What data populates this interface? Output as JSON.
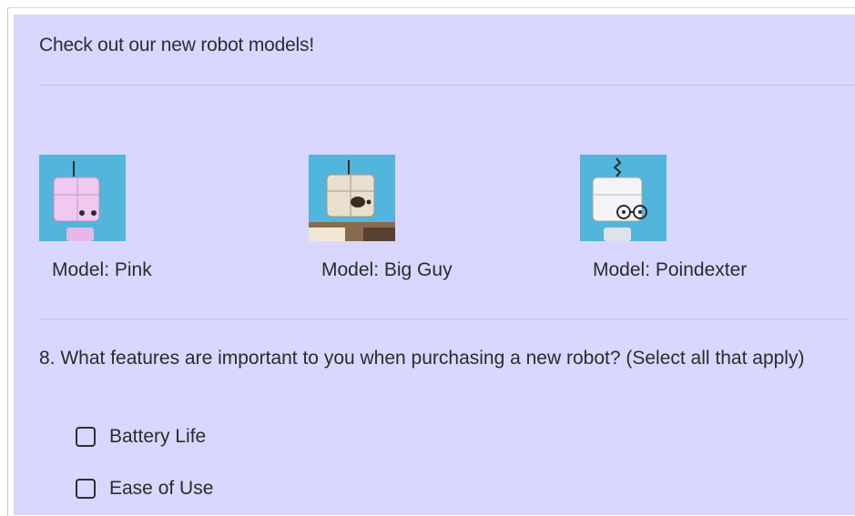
{
  "intro": {
    "text": "Check out our new robot models!"
  },
  "models": [
    {
      "caption": "Model: Pink",
      "image_icon": "robot-pink-icon"
    },
    {
      "caption": "Model: Big Guy",
      "image_icon": "robot-big-guy-icon"
    },
    {
      "caption": "Model: Poindexter",
      "image_icon": "robot-poindexter-icon"
    }
  ],
  "question": {
    "text": "8. What features are important to you when purchasing a new robot? (Select all that apply)"
  },
  "options": [
    {
      "label": "Battery Life",
      "checked": false
    },
    {
      "label": "Ease of Use",
      "checked": false
    }
  ],
  "colors": {
    "panel_background": "#d9d7ff",
    "thumbnail_background": "#52b5dc",
    "divider": "#c3c1e6"
  }
}
